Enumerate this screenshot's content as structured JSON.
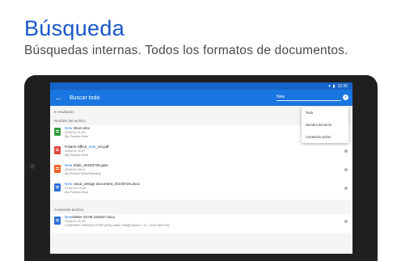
{
  "header": {
    "title": "Búsqueda",
    "subtitle": "Búsquedas internas. Todos los formatos de documentos."
  },
  "statusbar": {
    "time": "12:30"
  },
  "appbar": {
    "back_icon": "arrow-left-icon",
    "title": "Buscar todo",
    "query": "New",
    "clear_icon": "clear-circle-icon"
  },
  "results": {
    "count_label": "5 resultados",
    "sections": [
      {
        "label": "Nombre del archivo",
        "items": [
          {
            "type": "xls",
            "icon": "spreadsheet-file-icon",
            "name_hl": "New",
            "name_rest": " sheet.xlsx",
            "date": "2016/14 21:33",
            "location": "My Polaris Drive"
          },
          {
            "type": "pdf",
            "icon": "pdf-file-icon",
            "name_pre": "Polaris Office_",
            "name_hl": "new",
            "name_rest": "_ver.pdf",
            "date": "2016/14 22:47",
            "location": "My Polaris Drive"
          },
          {
            "type": "ppt",
            "icon": "presentation-file-icon",
            "name_hl": "New",
            "name_rest": " Slide_20100725.pptx",
            "date": "2016/14 18:11",
            "location": "My Polaris Drive/Ramsey"
          },
          {
            "type": "doc",
            "icon": "document-file-icon",
            "name_hl": "New",
            "name_rest": " cloud_design document_20100725.docx",
            "date": "07/11/14 19:32",
            "location": "My Polaris Drive"
          }
        ]
      },
      {
        "label": "Contenido archivo",
        "items": [
          {
            "type": "doc",
            "icon": "document-file-icon",
            "name_hl": "New",
            "name_rest": "sletter 03.09.181647.docx",
            "date": "2016/14 21:33",
            "location": "COMPANY NEWSLETTER [Entry Main Title][Volume 1 # 7 2016 MM DD]"
          }
        ]
      }
    ]
  },
  "menu": {
    "items": [
      "Todo",
      "Nombre del archi",
      "Contenido archiv"
    ]
  }
}
